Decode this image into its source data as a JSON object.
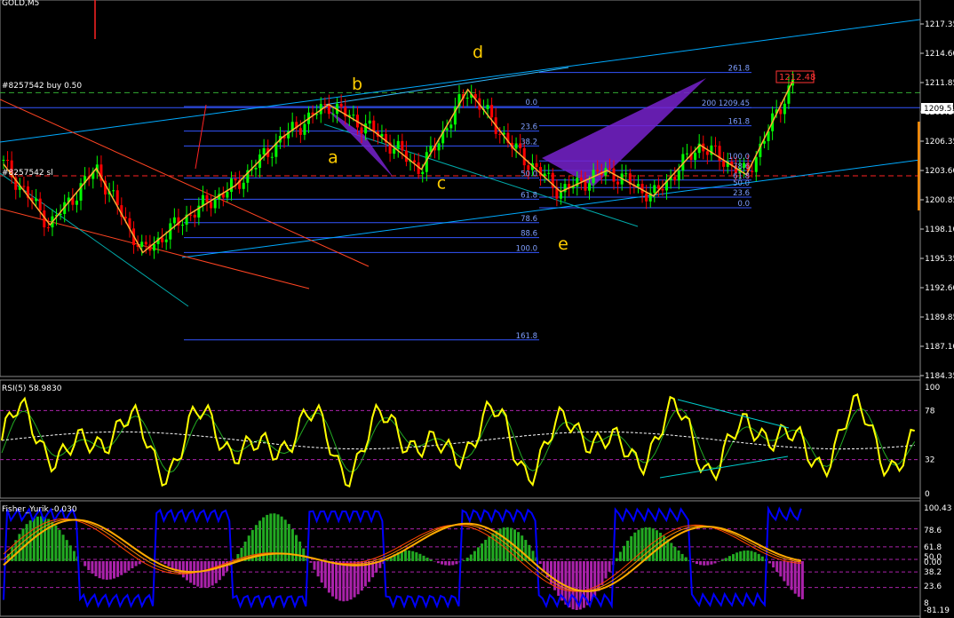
{
  "chart_data": {
    "type": "candlestick",
    "symbol_title": "GOLD,M5",
    "main_panel": {
      "price_axis": {
        "range": [
          1184.35,
          1217.35
        ],
        "ticks": [
          "1217.35",
          "1214.60",
          "1211.85",
          "1209.10",
          "1206.35",
          "1203.60",
          "1200.85",
          "1198.10",
          "1195.35",
          "1192.60",
          "1189.85",
          "1187.10",
          "1184.35"
        ]
      },
      "current_price": "1209.51",
      "order_labels": {
        "buy": "#8257542 buy 0.50",
        "sl": "#8257542 sl"
      },
      "buy_level": 1210.9,
      "sl_level": 1203.1,
      "tp_box_label": "1212.48",
      "wave_labels": [
        {
          "text": "a",
          "price": 1204.3
        },
        {
          "text": "b",
          "price": 1211.2
        },
        {
          "text": "c",
          "price": 1201.9
        },
        {
          "text": "d",
          "price": 1214.2
        },
        {
          "text": "e",
          "price": 1196.2
        }
      ],
      "zigzag_left": [
        1204.2,
        1198.5,
        1203.8,
        1195.9,
        1199.5,
        1202.2,
        1206.7,
        1209.8,
        1207.2,
        1203.7,
        1211.2,
        1205.6,
        1201.6,
        1203.6,
        1201.2,
        1206.0,
        1203.2,
        1212.0
      ],
      "fibo_left": [
        {
          "label": "0.0",
          "price": 1209.6
        },
        {
          "label": "23.6",
          "price": 1207.3
        },
        {
          "label": "38.2",
          "price": 1205.9
        },
        {
          "label": "50.0",
          "price": 1202.9
        },
        {
          "label": "61.8",
          "price": 1200.9
        },
        {
          "label": "78.6",
          "price": 1198.7
        },
        {
          "label": "88.6",
          "price": 1197.3
        },
        {
          "label": "100.0",
          "price": 1195.9
        },
        {
          "label": "161.8",
          "price": 1187.7
        }
      ],
      "fibo_right": [
        {
          "label": "261.8",
          "price": 1212.8
        },
        {
          "label": "200 1209.45",
          "price": 1209.5
        },
        {
          "label": "161.8",
          "price": 1207.8
        },
        {
          "label": "100.0",
          "price": 1204.5
        },
        {
          "label": "78.6",
          "price": 1203.6
        },
        {
          "label": "61.8",
          "price": 1202.7
        },
        {
          "label": "50.0",
          "price": 1202.0
        },
        {
          "label": "23.6",
          "price": 1201.1
        },
        {
          "label": "0.0",
          "price": 1200.1
        }
      ]
    },
    "rsi_panel": {
      "title": "RSI(5) 58.9830",
      "range": [
        0,
        100
      ],
      "ticks": [
        "100",
        "78",
        "32",
        "0"
      ],
      "levels": [
        78,
        32
      ]
    },
    "fisher_panel": {
      "title": "Fisher_Yurik -0.030",
      "ticks": [
        "100.43",
        "78.6",
        "61.8",
        "50.0",
        "0.00",
        "38.2",
        "23.6",
        "8",
        "-81.19"
      ],
      "levels": [
        78.6,
        61.8,
        50.0,
        38.2,
        23.6
      ]
    }
  },
  "colors": {
    "background": "#000000",
    "bull_candle": "#00ff00",
    "bear_candle": "#ff0000",
    "fib_line": "#3355ff",
    "wave_label": "#ffcc00",
    "zigzag": "#ffaa33",
    "channel": "#00aaff",
    "harmonic_fill": "#7722cc",
    "rsi": "#ffff00",
    "fisher_line": "#ffaa00",
    "fisher_blue": "#0000ff",
    "hist_pos": "#22aa22",
    "hist_neg": "#aa22aa"
  }
}
